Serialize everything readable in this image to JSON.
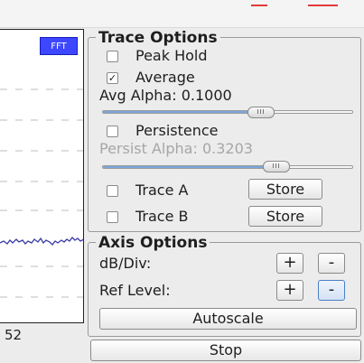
{
  "plot": {
    "badge": "FFT",
    "x_tick_label": "52"
  },
  "trace_options": {
    "title": "Trace Options",
    "peak_hold": {
      "label": "Peak Hold",
      "checked": false
    },
    "average": {
      "label": "Average",
      "checked": true
    },
    "avg_alpha": {
      "label": "Avg Alpha: 0.1000",
      "level": 0.66
    },
    "persistence": {
      "label": "Persistence",
      "checked": false
    },
    "persist_alpha": {
      "label": "Persist Alpha: 0.3203",
      "level": 0.66,
      "enabled": false
    },
    "trace_a": {
      "label": "Trace A",
      "checked": false,
      "store_label": "Store"
    },
    "trace_b": {
      "label": "Trace B",
      "checked": false,
      "store_label": "Store"
    }
  },
  "axis_options": {
    "title": "Axis Options",
    "db_div": {
      "label": "dB/Div:",
      "plus": "+",
      "minus": "-"
    },
    "ref_level": {
      "label": "Ref Level:",
      "plus": "+",
      "minus": "-"
    },
    "autoscale_label": "Autoscale"
  },
  "stop_label": "Stop",
  "colors": {
    "badge_bg": "#3d47ff",
    "slider_fill": "#7aa6dc",
    "focus_border": "#4a7fc7"
  }
}
